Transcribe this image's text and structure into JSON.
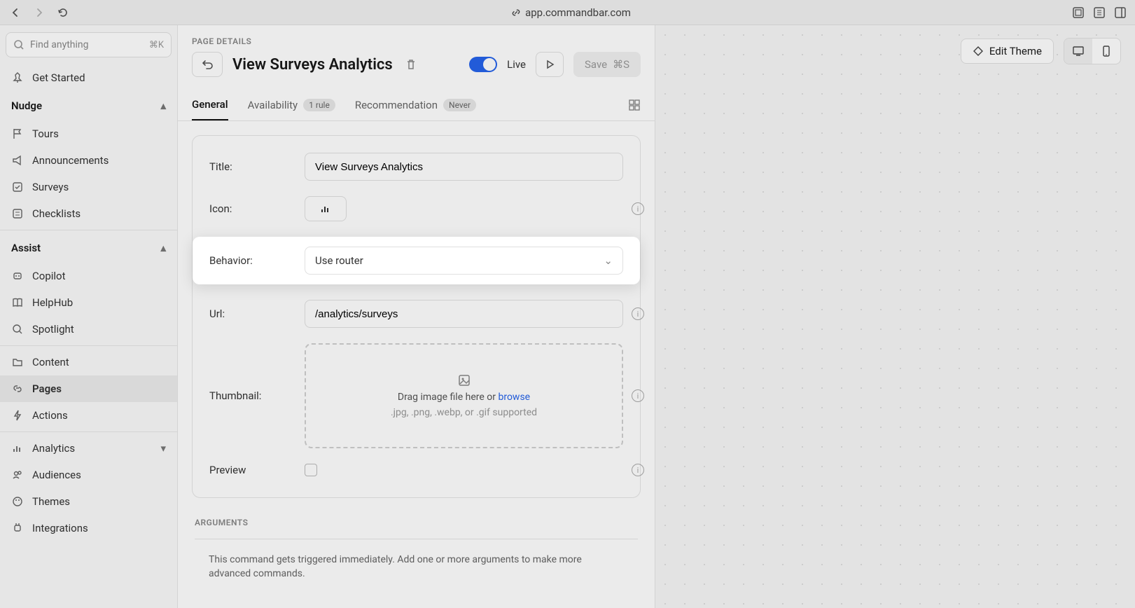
{
  "browser": {
    "url": "app.commandbar.com"
  },
  "search": {
    "placeholder": "Find anything",
    "shortcut": "⌘K"
  },
  "sidebar": {
    "get_started": "Get Started",
    "section1": "Nudge",
    "items1": [
      "Tours",
      "Announcements",
      "Surveys",
      "Checklists"
    ],
    "section2": "Assist",
    "items2": [
      "Copilot",
      "HelpHub",
      "Spotlight"
    ],
    "items3": [
      "Content",
      "Pages",
      "Actions"
    ],
    "items4": [
      "Analytics",
      "Audiences",
      "Themes",
      "Integrations"
    ]
  },
  "editor": {
    "details_label": "PAGE DETAILS",
    "page_title": "View Surveys Analytics",
    "live_label": "Live",
    "save_label": "Save",
    "save_shortcut": "⌘S",
    "tabs": {
      "general": "General",
      "availability": "Availability",
      "availability_badge": "1 rule",
      "recommendation": "Recommendation",
      "recommendation_badge": "Never"
    },
    "form": {
      "title_label": "Title:",
      "title_value": "View Surveys Analytics",
      "icon_label": "Icon:",
      "behavior_label": "Behavior:",
      "behavior_value": "Use router",
      "url_label": "Url:",
      "url_value": "/analytics/surveys",
      "thumbnail_label": "Thumbnail:",
      "thumbnail_drag": "Drag image file here or ",
      "thumbnail_browse": "browse",
      "thumbnail_hint": ".jpg, .png, .webp, or .gif supported",
      "preview_label": "Preview"
    },
    "arguments_label": "ARGUMENTS",
    "arguments_desc": "This command gets triggered immediately. Add one or more arguments to make more advanced commands."
  },
  "canvas": {
    "edit_theme": "Edit Theme"
  }
}
